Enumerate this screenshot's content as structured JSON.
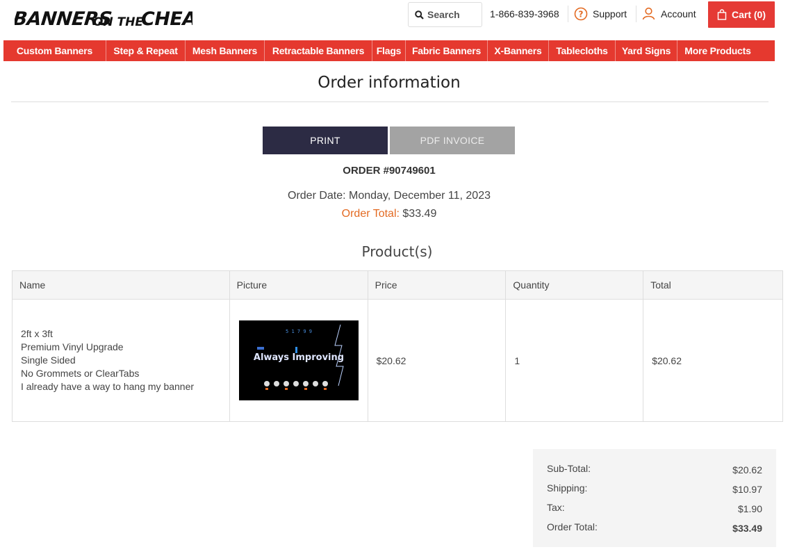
{
  "brand": {
    "logo_text": "BANNERS ON THE CHEAP",
    "accent": "#e5392f"
  },
  "header": {
    "search_label": "Search",
    "phone": "1-866-839-3968",
    "support_label": "Support",
    "account_label": "Account",
    "cart_label": "Cart (0)"
  },
  "nav": [
    "Custom Banners",
    "Step & Repeat",
    "Mesh Banners",
    "Retractable Banners",
    "Flags",
    "Fabric Banners",
    "X-Banners",
    "Tablecloths",
    "Yard Signs",
    "More Products"
  ],
  "page": {
    "title": "Order information",
    "print_label": "PRINT",
    "pdf_label": "PDF INVOICE",
    "order_number": "ORDER #90749601",
    "order_date": "Order Date: Monday, December 11, 2023",
    "order_total_label": "Order Total:",
    "order_total_value": "$33.49",
    "products_title": "Product(s)"
  },
  "table": {
    "headers": [
      "Name",
      "Picture",
      "Price",
      "Quantity",
      "Total"
    ],
    "rows": [
      {
        "name_lines": [
          "2ft x 3ft",
          "Premium Vinyl Upgrade",
          "Single Sided",
          "No Grommets or ClearTabs",
          "I already have a way to hang my banner"
        ],
        "picture_top_text": "5 1 7 9 9",
        "picture_main_text": "Always Improving",
        "price": "$20.62",
        "quantity": "1",
        "total": "$20.62"
      }
    ]
  },
  "summary": [
    {
      "label": "Sub-Total:",
      "value": "$20.62"
    },
    {
      "label": "Shipping:",
      "value": "$10.97"
    },
    {
      "label": "Tax:",
      "value": "$1.90"
    },
    {
      "label": "Order Total:",
      "value": "$33.49"
    }
  ]
}
